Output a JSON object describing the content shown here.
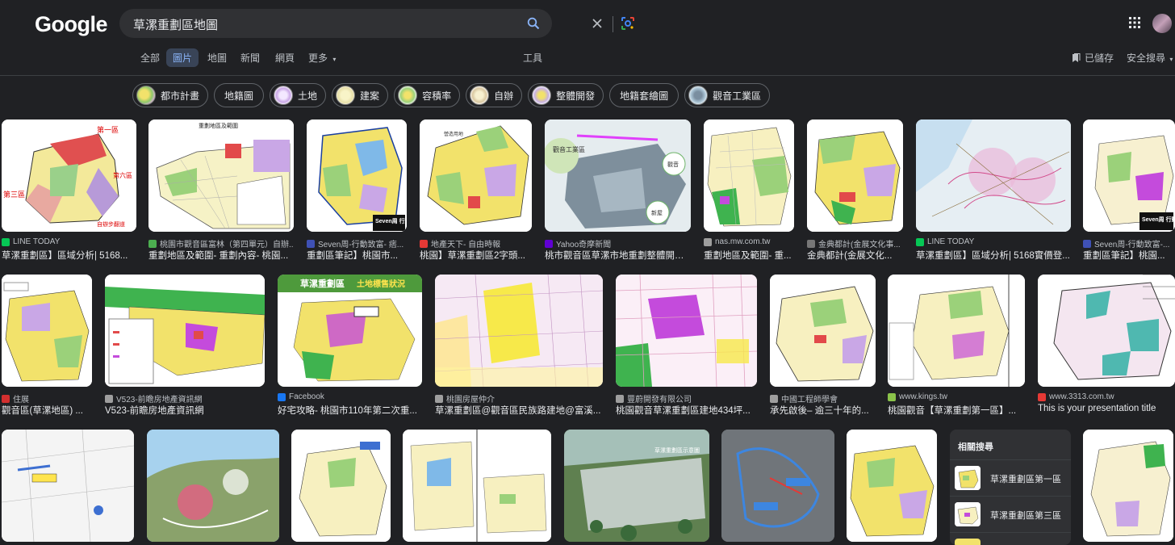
{
  "header": {
    "logo": "Google",
    "query": "草漯重劃區地圖"
  },
  "tabs": [
    {
      "label": "全部"
    },
    {
      "label": "圖片"
    },
    {
      "label": "地圖"
    },
    {
      "label": "新聞"
    },
    {
      "label": "網頁"
    },
    {
      "label": "更多"
    }
  ],
  "tools_label": "工具",
  "saved_label": "已儲存",
  "safe_search_label": "安全搜尋",
  "chips": [
    {
      "label": "都市計畫"
    },
    {
      "label": "地籍圖"
    },
    {
      "label": "土地"
    },
    {
      "label": "建案"
    },
    {
      "label": "容積率"
    },
    {
      "label": "自辦"
    },
    {
      "label": "整體開發"
    },
    {
      "label": "地籍套繪圖"
    },
    {
      "label": "觀音工業區"
    }
  ],
  "results_row1": [
    {
      "source": "LINE TODAY",
      "title": "草漯重劃區】區域分析| 5168...",
      "fav": "#06c755"
    },
    {
      "source": "桃園市觀音區富林（第四單元）自辦...",
      "title": "重劃地區及範圍- 重劃內容- 桃園...",
      "fav": "#4caf50"
    },
    {
      "source": "Seven周-行動致富- 痞...",
      "title": "重劃區筆記】桃園市...",
      "fav": "#3f51b5"
    },
    {
      "source": "地產天下- 自由時報",
      "title": "桃園】草漯重劃區2字頭...",
      "fav": "#e53935"
    },
    {
      "source": "Yahoo奇摩新聞",
      "title": "桃市觀音區草漯市地重劃整體開發...",
      "fav": "#6001d2"
    },
    {
      "source": "nas.mw.com.tw",
      "title": "重劃地區及範圍- 重...",
      "fav": "#9e9e9e"
    },
    {
      "source": "金典都計(金展文化事...",
      "title": "金典都計(金展文化...",
      "fav": "#777777"
    },
    {
      "source": "LINE TODAY",
      "title": "草漯重劃區】區域分析| 5168實價登...",
      "fav": "#06c755"
    },
    {
      "source": "Seven周-行動致富-...",
      "title": "重劃區筆記】桃園...",
      "fav": "#3f51b5"
    }
  ],
  "results_row2": [
    {
      "source": "住展",
      "title": "觀音區(草漯地區) ...",
      "fav": "#d32f2f"
    },
    {
      "source": "V523-前瞻房地產資訊網",
      "title": "V523-前瞻房地產資訊網",
      "fav": "#9e9e9e"
    },
    {
      "source": "Facebook",
      "title": "好宅攻略- 桃園市110年第二次重...",
      "fav": "#1877f2"
    },
    {
      "source": "桃園房屋仲介",
      "title": "草漯重劃區@觀音區民族路建地@富溪...",
      "fav": "#9e9e9e"
    },
    {
      "source": "豐蔚開發有限公司",
      "title": "桃園觀音草漯重劃區建地434坪...",
      "fav": "#9e9e9e"
    },
    {
      "source": "中國工程師學會",
      "title": "承先啟後– 逾三十年的...",
      "fav": "#9e9e9e"
    },
    {
      "source": "www.kings.tw",
      "title": "桃園觀音【草漯重劃第一區】...",
      "fav": "#8bc34a"
    },
    {
      "source": "www.3313.com.tw",
      "title": "This is your presentation title",
      "fav": "#e53935"
    }
  ],
  "image_labels": {
    "r1_1_a": "第一區",
    "r1_1_b": "第六區",
    "r1_1_c": "第三區",
    "r1_1_d": "自辦步翻道",
    "r1_2_title": "重劃地區及範圍",
    "r1_4_a": "營造用地",
    "r1_5_a": "觀音工業區",
    "r1_5_b": "觀音",
    "r1_5_c": "新屋",
    "r1_3_seven": "Seven周 行動致富",
    "r1_9_seven": "Seven周 行動致富",
    "r2_3_title": "草漯重劃區",
    "r2_3_sub": "土地標售狀況",
    "r3_6_label": "草漯重劃區示意圖"
  },
  "related": {
    "heading": "相關搜尋",
    "items": [
      {
        "label": "草漯重劃區第一區"
      },
      {
        "label": "草漯重劃區第三區"
      }
    ]
  }
}
